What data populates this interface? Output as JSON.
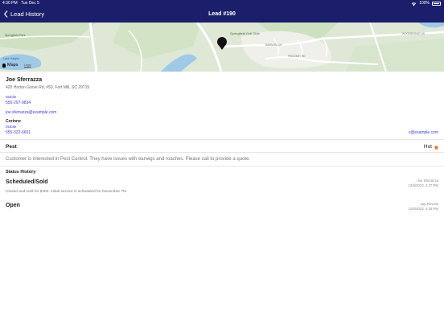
{
  "status_bar": {
    "time": "4:30 PM",
    "date": "Tue Dec 5",
    "battery": "100%"
  },
  "nav": {
    "back_label": "Lead History",
    "title": "Lead #190"
  },
  "map": {
    "attribution": "Maps",
    "legal": "Legal",
    "labels": {
      "golf_club": "Springfield Golf Club",
      "lake": "Lake Haigler",
      "road1": "BARBARA DR",
      "road2": "PINCKNEY RD",
      "road3": "WOODBRIDGE DR",
      "park": "Springfield Park"
    }
  },
  "lead": {
    "name": "Joe Sferrazza",
    "address": "420 Horton Grove Rd, #50, Fort Mill, SC 29715",
    "primary_phone_label": "Mobile",
    "primary_phone": "555-297-9834",
    "primary_email": "joe.sferrazza@example.com",
    "secondary_name": "Corinne",
    "secondary_phone_label": "Mobile",
    "secondary_phone": "555-322-6651",
    "secondary_email": "c@example.com"
  },
  "service": {
    "type": "Pest",
    "priority": "Hot",
    "notes": "Customer is interested in Pest Control.  They have issues with earwigs and roaches.  Please call to provide a quote."
  },
  "status_history": {
    "heading": "Status History",
    "entries": [
      {
        "status": "Scheduled/Sold",
        "by": "Joe Sferrazza",
        "timestamp": "12/5/2023, 4:27 PM",
        "note": "Closed and sold for $400.  Initial service is scheduled for December 7th."
      },
      {
        "status": "Open",
        "by": "App Review",
        "timestamp": "12/5/2023, 4:25 PM",
        "note": ""
      }
    ]
  },
  "colors": {
    "nav_bg": "#1b1f6b",
    "link": "#3b3bd6",
    "hot": "#e8541f"
  }
}
